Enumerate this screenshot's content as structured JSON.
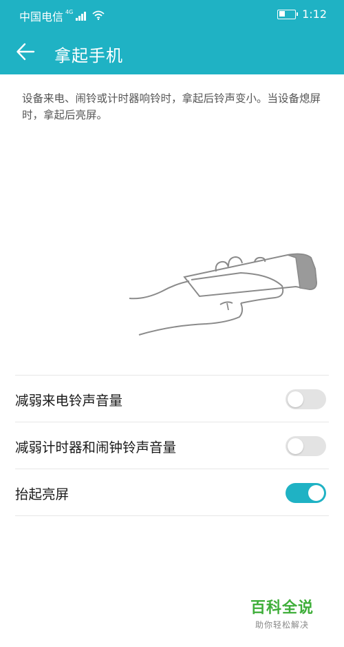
{
  "status_bar": {
    "carrier": "中国电信",
    "network": "4G",
    "time": "1:12",
    "battery_level": 0.4
  },
  "toolbar": {
    "title": "拿起手机"
  },
  "description": "设备来电、闹铃或计时器响铃时，拿起后铃声变小。当设备熄屏时，拿起后亮屏。",
  "settings": [
    {
      "label": "减弱来电铃声音量",
      "enabled": false
    },
    {
      "label": "减弱计时器和闹钟铃声音量",
      "enabled": false
    },
    {
      "label": "抬起亮屏",
      "enabled": true
    }
  ],
  "watermark": {
    "title": "百科全说",
    "subtitle": "助你轻松解决"
  },
  "colors": {
    "accent": "#1fb2c4",
    "switch_off": "#e3e3e3",
    "watermark_green": "#3fae3a"
  }
}
